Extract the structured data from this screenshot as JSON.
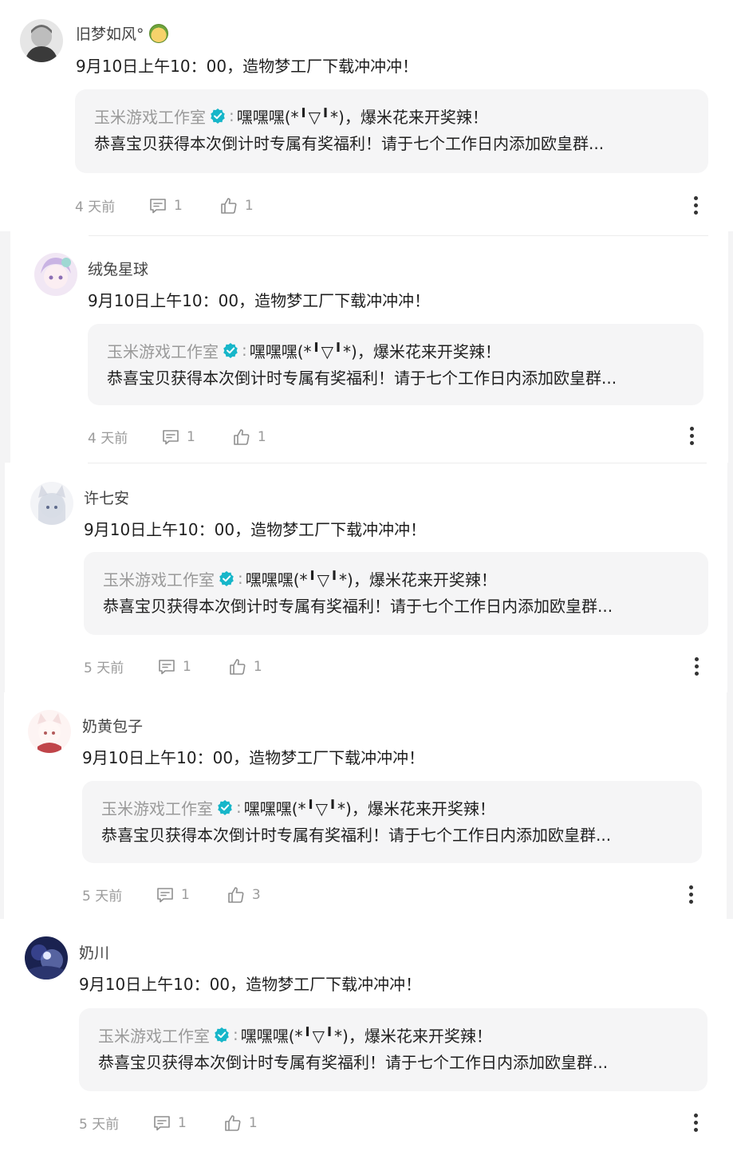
{
  "comments": [
    {
      "username": "旧梦如风°",
      "content": "9月10日上午10：00，造物梦工厂下载冲冲冲！",
      "quote": {
        "author": "玉米游戏工作室",
        "separator": ":",
        "line1": "嘿嘿嘿(*╹▽╹*)，爆米花来开奖辣！",
        "line2": "恭喜宝贝获得本次倒计时专属有奖福利！请于七个工作日内添加欧皇群..."
      },
      "time": "4 天前",
      "reply_count": "1",
      "like_count": "1",
      "avatar_colors": [
        "#4a4a4a",
        "#d9d9d9"
      ]
    },
    {
      "username": "绒兔星球",
      "content": "9月10日上午10：00，造物梦工厂下载冲冲冲！",
      "quote": {
        "author": "玉米游戏工作室",
        "separator": ":",
        "line1": "嘿嘿嘿(*╹▽╹*)，爆米花来开奖辣！",
        "line2": "恭喜宝贝获得本次倒计时专属有奖福利！请于七个工作日内添加欧皇群..."
      },
      "time": "4 天前",
      "reply_count": "1",
      "like_count": "1",
      "avatar_colors": [
        "#cdb6e6",
        "#f7e4ef"
      ]
    },
    {
      "username": "许七安",
      "content": "9月10日上午10：00，造物梦工厂下载冲冲冲！",
      "quote": {
        "author": "玉米游戏工作室",
        "separator": ":",
        "line1": "嘿嘿嘿(*╹▽╹*)，爆米花来开奖辣！",
        "line2": "恭喜宝贝获得本次倒计时专属有奖福利！请于七个工作日内添加欧皇群..."
      },
      "time": "5 天前",
      "reply_count": "1",
      "like_count": "1",
      "avatar_colors": [
        "#e8eaf0",
        "#8d95a8"
      ]
    },
    {
      "username": "奶黄包子",
      "content": "9月10日上午10：00，造物梦工厂下载冲冲冲！",
      "quote": {
        "author": "玉米游戏工作室",
        "separator": ":",
        "line1": "嘿嘿嘿(*╹▽╹*)，爆米花来开奖辣！",
        "line2": "恭喜宝贝获得本次倒计时专属有奖福利！请于七个工作日内添加欧皇群..."
      },
      "time": "5 天前",
      "reply_count": "1",
      "like_count": "3",
      "avatar_colors": [
        "#fbeeee",
        "#c0454a"
      ]
    },
    {
      "username": "奶川",
      "content": "9月10日上午10：00，造物梦工厂下载冲冲冲！",
      "quote": {
        "author": "玉米游戏工作室",
        "separator": ":",
        "line1": "嘿嘿嘿(*╹▽╹*)，爆米花来开奖辣！",
        "line2": "恭喜宝贝获得本次倒计时专属有奖福利！请于七个工作日内添加欧皇群..."
      },
      "time": "5 天前",
      "reply_count": "1",
      "like_count": "1",
      "avatar_colors": [
        "#1f2a5c",
        "#9aa8e0"
      ]
    }
  ],
  "colors": {
    "verify_badge": "#17b6c9",
    "meta_text": "#9b9b9b",
    "quote_bg": "#f5f5f6"
  },
  "icons": {
    "verify": "verified-check-icon",
    "reply": "comment-bubble-icon",
    "like": "thumbs-up-icon",
    "more": "more-vertical-icon"
  }
}
